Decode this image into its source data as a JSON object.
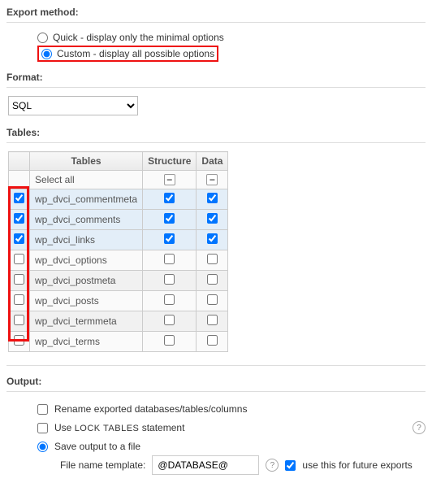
{
  "export": {
    "title": "Export method:",
    "quick": "Quick - display only the minimal options",
    "custom": "Custom - display all possible options"
  },
  "format": {
    "title": "Format:",
    "value": "SQL"
  },
  "tables": {
    "title": "Tables:",
    "headers": {
      "tables": "Tables",
      "structure": "Structure",
      "data": "Data"
    },
    "select_all": "Select all",
    "rows": [
      {
        "name": "wp_dvci_commentmeta",
        "sel": true
      },
      {
        "name": "wp_dvci_comments",
        "sel": true
      },
      {
        "name": "wp_dvci_links",
        "sel": true
      },
      {
        "name": "wp_dvci_options",
        "sel": false
      },
      {
        "name": "wp_dvci_postmeta",
        "sel": false
      },
      {
        "name": "wp_dvci_posts",
        "sel": false
      },
      {
        "name": "wp_dvci_termmeta",
        "sel": false
      },
      {
        "name": "wp_dvci_terms",
        "sel": false
      }
    ]
  },
  "output": {
    "title": "Output:",
    "rename": "Rename exported databases/tables/columns",
    "lock_pre": "Use ",
    "lock_small": "LOCK TABLES",
    "lock_post": " statement",
    "save": "Save output to a file",
    "template_label": "File name template:",
    "template_value": "@DATABASE@",
    "future": "use this for future exports"
  },
  "icons": {
    "minus": "−",
    "help": "?"
  }
}
